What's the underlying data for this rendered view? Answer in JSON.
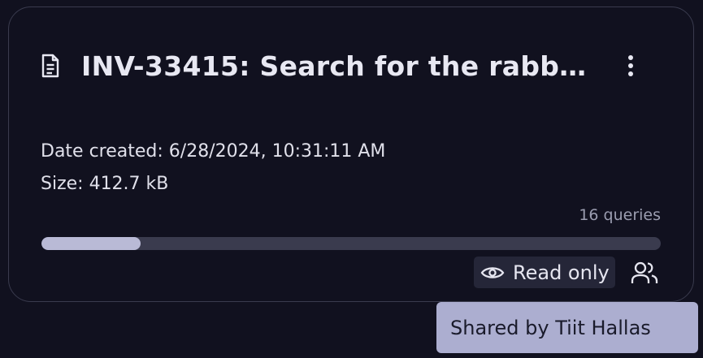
{
  "card": {
    "title": "INV-33415: Search for the rabb…",
    "date_created": "Date created: 6/28/2024, 10:31:11 AM",
    "size": "Size: 412.7 kB",
    "queries": "16 queries",
    "progress_fraction": 0.16,
    "access_label": "Read only",
    "icons": {
      "document": "document-icon",
      "menu": "more-vertical-icon",
      "access": "eye-icon",
      "shared": "users-icon"
    }
  },
  "tooltip": {
    "text": "Shared by Tiit Hallas"
  },
  "colors": {
    "background": "#11111f",
    "border": "#3a3b4e",
    "progress_fill": "#b9bad6",
    "progress_track": "#3a3b4e",
    "chip_bg": "#252638",
    "tooltip_bg": "#acaed0"
  }
}
